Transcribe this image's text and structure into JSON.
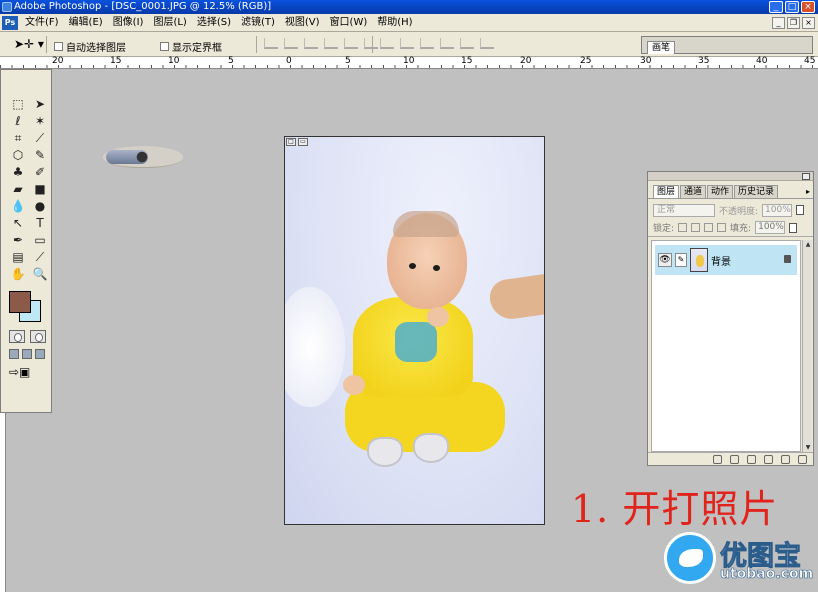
{
  "window": {
    "title": "Adobe Photoshop - [DSC_0001.JPG @ 12.5% (RGB)]",
    "min": "_",
    "max": "□",
    "close": "×"
  },
  "menu": [
    "文件(F)",
    "编辑(E)",
    "图像(I)",
    "图层(L)",
    "选择(S)",
    "滤镜(T)",
    "视图(V)",
    "窗口(W)",
    "帮助(H)"
  ],
  "doc_controls": {
    "min": "_",
    "restore": "❐",
    "close": "×"
  },
  "options": {
    "auto_select": "自动选择图层",
    "show_bounds": "显示定界框",
    "palette_tab": "画笔"
  },
  "ruler_labels": [
    "20",
    "15",
    "10",
    "5",
    "0",
    "5",
    "10",
    "15",
    "20",
    "25",
    "30",
    "35",
    "40",
    "45"
  ],
  "layers_palette": {
    "tabs": [
      "图层",
      "通道",
      "动作",
      "历史记录"
    ],
    "blend_mode": "正常",
    "opacity_label": "不透明度:",
    "opacity_value": "100%",
    "lock_label": "锁定:",
    "fill_label": "填充:",
    "fill_value": "100%",
    "layer_name": "背景"
  },
  "annotation": "1. 开打照片",
  "watermark": {
    "name": "优图宝",
    "url": "utobao.com"
  },
  "colors": {
    "foreground": "#8b5a48",
    "background": "#bfe8f7",
    "annotation": "#e0241c"
  }
}
